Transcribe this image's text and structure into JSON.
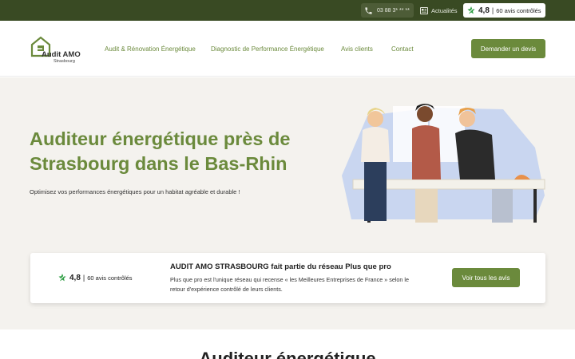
{
  "topbar": {
    "phone": "03 88 3* ** **",
    "news_label": "Actualités",
    "rating": {
      "score": "4,8",
      "separator": "|",
      "count": "60 avis contrôlés"
    }
  },
  "header": {
    "logo": {
      "name": "Audit AMO",
      "sub": "Strasbourg"
    },
    "nav": [
      "Audit & Rénovation Énergétique",
      "Diagnostic de Performance Énergétique",
      "Avis clients",
      "Contact"
    ],
    "cta_label": "Demander un devis"
  },
  "hero": {
    "title": "Auditeur énergétique près de Strasbourg dans le Bas-Rhin",
    "subtitle": "Optimisez vos performances énergétiques pour un habitat agréable et durable !"
  },
  "review": {
    "score": "4,8",
    "separator": "|",
    "count": "60 avis contrôlés",
    "title": "AUDIT AMO STRASBOURG fait partie du réseau Plus que pro",
    "text": "Plus que pro est l'unique réseau qui recense « les Meilleures Entreprises de France » selon le retour d'expérience contrôlé de leurs clients.",
    "button_label": "Voir tous les avis"
  },
  "bottom": {
    "heading": "Auditeur énergétique"
  },
  "colors": {
    "brand_green": "#6b8a3c",
    "topbar_bg": "#394a23",
    "hero_bg": "#f4f2ee"
  },
  "icons": [
    "phone-icon",
    "newspaper-icon",
    "star-icon",
    "logo-house-icon"
  ]
}
